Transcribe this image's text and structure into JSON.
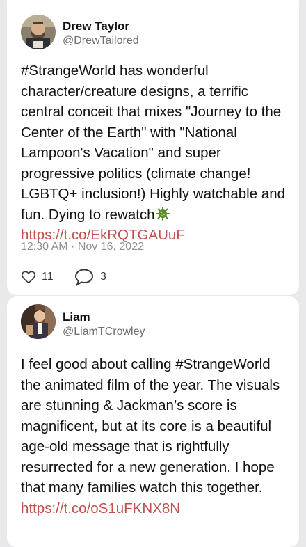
{
  "tweets": [
    {
      "name": "Drew Taylor",
      "handle": "@DrewTailored",
      "text": "#StrangeWorld has wonderful character/creature designs, a terrific central conceit that mixes \"Journey to the Center of the Earth\" with \"National Lampoon's Vacation\" and super progressive politics (climate change! LGBTQ+ inclusion!) Highly watchable and fun. Dying to rewatch",
      "emoji_icon": "microbe-emoji-icon",
      "link": "https://t.co/EkRQTGAUuF",
      "timestamp": "12:30 AM · Nov 16, 2022",
      "likes": "11",
      "replies": "3"
    },
    {
      "name": "Liam",
      "handle": "@LiamTCrowley",
      "text": "I feel good about calling #StrangeWorld the animated film of the year. The visuals are stunning & Jackman’s score is magnificent, but at its core is a beautiful age-old message that is rightfully resurrected for a new generation. I hope that many families watch this together.",
      "link": "https://t.co/oS1uFKNX8N"
    }
  ],
  "colors": {
    "background": "#e9e9ec",
    "card": "#ffffff",
    "link": "#c0504d",
    "secondary_text": "#6e6e73"
  }
}
